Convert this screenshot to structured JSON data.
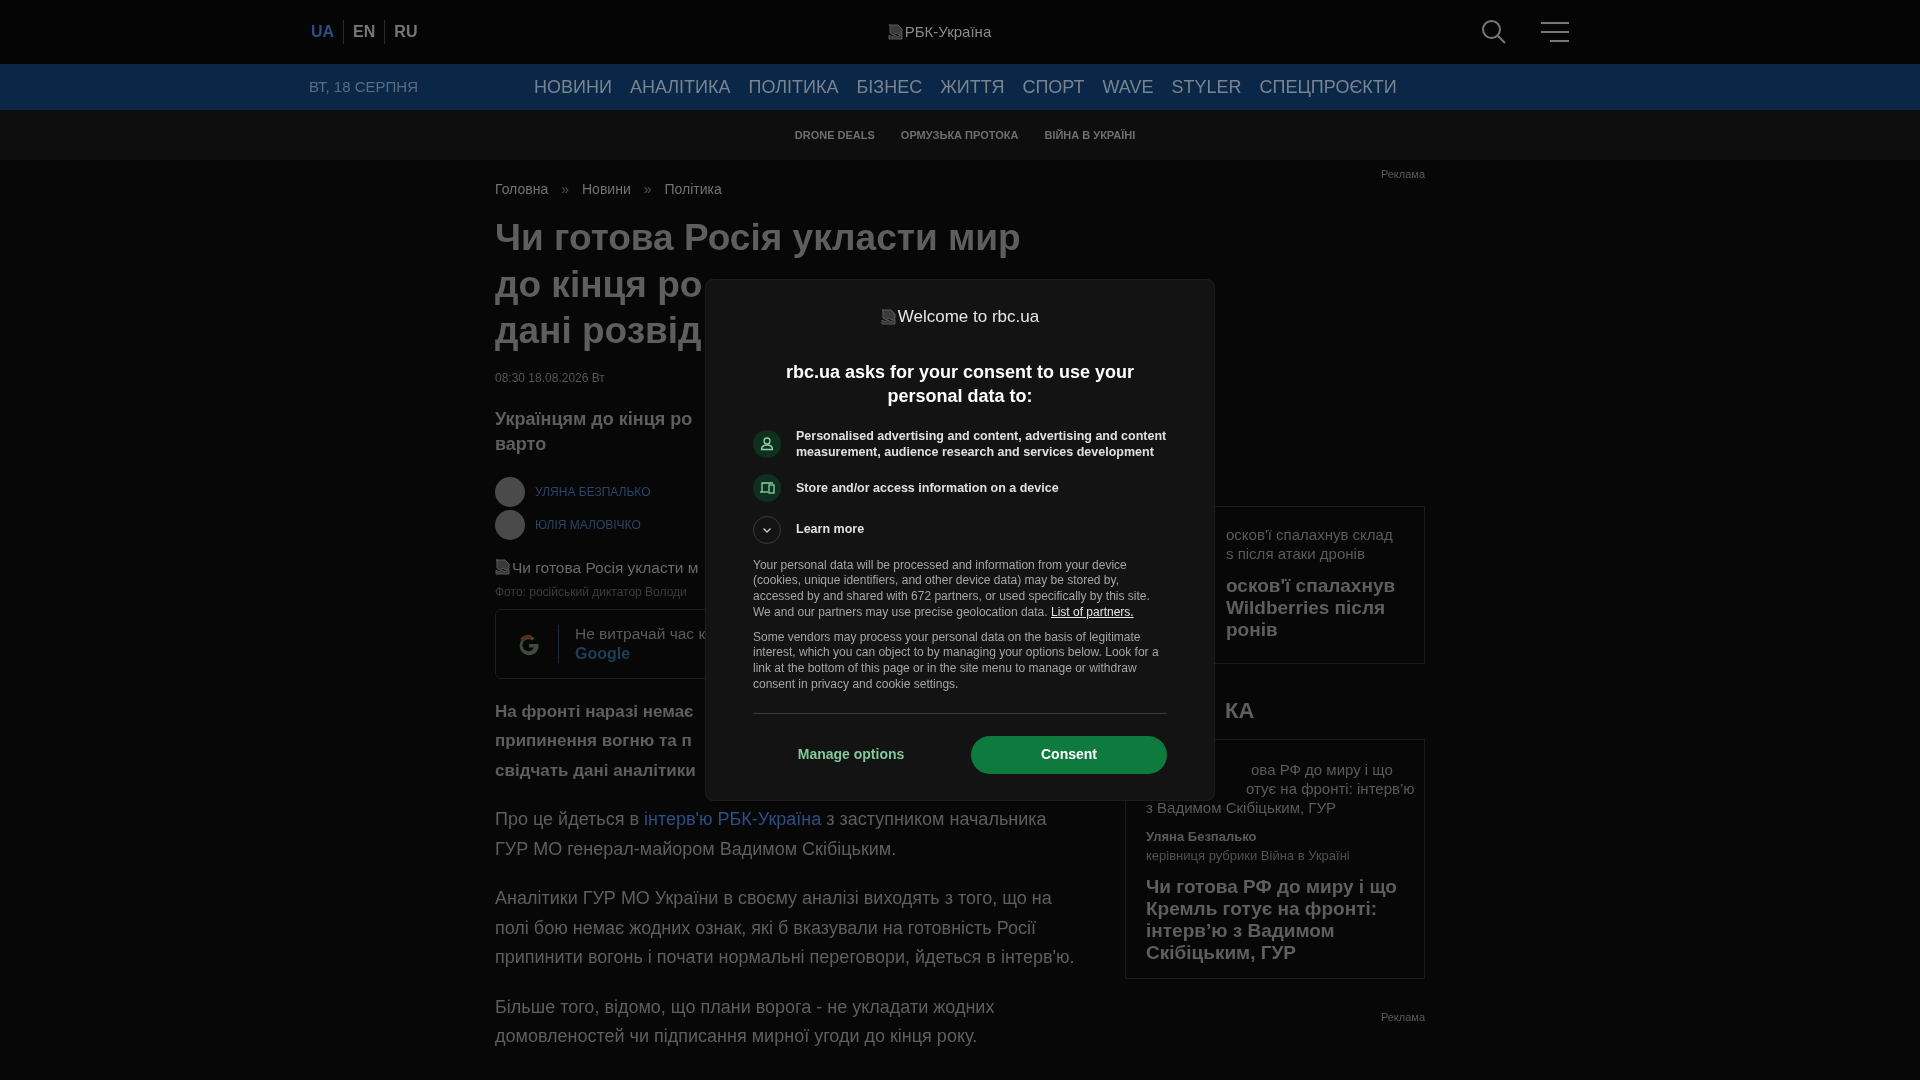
{
  "header": {
    "languages": [
      {
        "label": "UA",
        "selected": true
      },
      {
        "label": "EN",
        "selected": false
      },
      {
        "label": "RU",
        "selected": false
      }
    ],
    "logo_alt": "РБК-Україна"
  },
  "nav": {
    "date": "ВТ, 18 СЕРПНЯ",
    "items": [
      "НОВИНИ",
      "АНАЛІТИКА",
      "ПОЛІТИКА",
      "БІЗНЕС",
      "ЖИТТЯ",
      "СПОРТ",
      "WAVE",
      "STYLER",
      "СПЕЦПРОЄКТИ"
    ]
  },
  "subnav": {
    "items": [
      "DRONE DEALS",
      "ОРМУЗЬКА ПРОТОКА",
      "ВІЙНА В УКРАЇНІ"
    ]
  },
  "breadcrumbs": [
    {
      "kind": "link",
      "text": "Головна"
    },
    {
      "kind": "separator",
      "text": "»"
    },
    {
      "kind": "link",
      "text": "Новини"
    },
    {
      "kind": "separator",
      "text": "»"
    },
    {
      "kind": "link",
      "text": "Політика"
    }
  ],
  "article": {
    "title_lines": [
      "Чи готова Росія укласти мир",
      "до кінця ро",
      "дані розвід"
    ],
    "date": "08:30 18.08.2026 Вт",
    "lead_lines": [
      "Українцям до кінця ро",
      "варто"
    ],
    "authors": [
      "УЛЯНА БЕЗПАЛЬКО",
      "ЮЛІЯ МАЛОВІЧКО"
    ],
    "image_alt": "Чи готова Росія укласти м",
    "photo_caption": "Фото: російський диктатор Володи",
    "promo": {
      "text": "Не витрачай час к",
      "link": "Google"
    },
    "bold_lines": [
      "На фронті наразі немає",
      "припинення вогню та п",
      "свідчать дані аналітики"
    ],
    "paragraphs": [
      {
        "parts": [
          {
            "kind": "text",
            "text": "Про це йдеться в "
          },
          {
            "kind": "link",
            "text": "інтерв'ю РБК-Україна"
          },
          {
            "kind": "text",
            "text": " з заступником начальника ГУР МО генерал-майором Вадимом Скібіцьким."
          }
        ]
      },
      {
        "parts": [
          {
            "kind": "text",
            "text": "Аналітики ГУР МО України в своєму аналізі виходять з того, що на полі бою немає жодних ознак, які б вказували на готовність Росії припинити вогонь і почати нормальні переговори, йдеться в інтерв'ю."
          }
        ]
      },
      {
        "parts": [
          {
            "kind": "text",
            "text": "Більше того, відомо, що плани ворога - не укладати жодних домовленостей чи підписання мирної угоди до кінця року."
          }
        ]
      }
    ]
  },
  "sidebar": {
    "ads": [
      "Реклама",
      "Реклама"
    ],
    "card1": {
      "lead_lines": [
        "осков'ї спалахнув склад",
        "s після атаки дронів"
      ],
      "title_lines": [
        "осков'ї спалахнув",
        "Wildberries після",
        "ронів"
      ]
    },
    "section_heading": "КА",
    "card2": {
      "lead_lines": [
        "ова РФ до миру і що",
        "отує на фронті: інтерв’ю",
        "з Вадимом Скібіцьким, ГУР"
      ],
      "author": "Уляна Безпалько",
      "author_role": "керівниця рубрики Війна в Україні",
      "title": "Чи готова РФ до миру і що Кремль готує на фронті: інтерв’ю з Вадимом Скібіцьким, ГУР"
    }
  },
  "consent_dialog": {
    "logo_alt": "Welcome to rbc.ua",
    "heading": "rbc.ua asks for your consent to use your personal data to:",
    "purposes": [
      {
        "kind": "person",
        "text": "Personalised advertising and content, advertising and content measurement, audience research and services development"
      },
      {
        "kind": "device",
        "text": "Store and/or access information on a device"
      }
    ],
    "learn_more": {
      "label": "Learn more",
      "expanded": false
    },
    "paragraphs": [
      {
        "text": "Your personal data will be processed and information from your device (cookies, unique identifiers, and other device data) may be stored by, accessed by and shared with 672 partners, or used specifically by this site. We and our partners may use precise geolocation data. ",
        "link": "List of partners."
      },
      {
        "text": "Some vendors may process your personal data on the basis of legitimate interest, which you can object to by managing your options below. Look for a link at the bottom of this page or in the site menu to manage or withdraw consent in privacy and cookie settings."
      }
    ],
    "buttons": {
      "manage": "Manage options",
      "consent": "Consent"
    }
  }
}
